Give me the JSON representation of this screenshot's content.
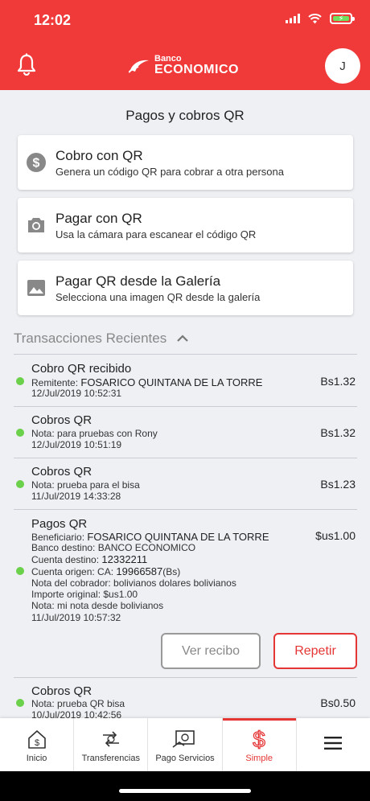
{
  "status": {
    "time": "12:02"
  },
  "header": {
    "logo_top": "Banco",
    "logo_bottom": "ECONOMICO",
    "avatar_initial": "J"
  },
  "page_title": "Pagos y cobros QR",
  "actions": [
    {
      "title": "Cobro con QR",
      "subtitle": "Genera un código QR para cobrar a otra persona",
      "icon": "dollar-circle-icon"
    },
    {
      "title": "Pagar con QR",
      "subtitle": "Usa la cámara para escanear el código QR",
      "icon": "camera-icon"
    },
    {
      "title": "Pagar QR desde la Galería",
      "subtitle": "Selecciona una imagen QR desde la galería",
      "icon": "image-icon"
    }
  ],
  "recent": {
    "heading": "Transacciones Recientes"
  },
  "transactions": [
    {
      "title": "Cobro QR recibido",
      "lines": [
        {
          "label": "Remitente:",
          "value": "FOSARICO QUINTANA DE LA TORRE"
        },
        {
          "label": "12/Jul/2019 10:52:31",
          "value": ""
        }
      ],
      "amount": "Bs1.32"
    },
    {
      "title": "Cobros QR",
      "lines": [
        {
          "label": "Nota: para pruebas con Rony",
          "value": ""
        },
        {
          "label": "12/Jul/2019 10:51:19",
          "value": ""
        }
      ],
      "amount": "Bs1.32"
    },
    {
      "title": "Cobros QR",
      "lines": [
        {
          "label": "Nota: prueba para el bisa",
          "value": ""
        },
        {
          "label": "11/Jul/2019 14:33:28",
          "value": ""
        }
      ],
      "amount": "Bs1.23"
    },
    {
      "title": "Pagos QR",
      "lines": [
        {
          "label": "Beneficiario:",
          "value": "FOSARICO QUINTANA DE LA TORRE"
        },
        {
          "label": "Banco destino: BANCO ECONOMICO",
          "value": ""
        },
        {
          "label": "Cuenta destino:",
          "value": "12332211"
        },
        {
          "label": "Cuenta origen:  CA:",
          "value": "19966587",
          "suffix": "(Bs)"
        },
        {
          "label": "Nota del cobrador: bolivianos dolares bolivianos",
          "value": ""
        },
        {
          "label": "Importe original: $us1.00",
          "value": ""
        },
        {
          "label": "Nota: mi nota desde bolivianos",
          "value": ""
        },
        {
          "label": "11/Jul/2019 10:57:32",
          "value": ""
        }
      ],
      "amount": "$us1.00"
    },
    {
      "title": "Cobros QR",
      "lines": [
        {
          "label": "Nota: prueba QR bisa",
          "value": ""
        },
        {
          "label": "10/Jul/2019 10:42:56",
          "value": ""
        }
      ],
      "amount": "Bs0.50"
    }
  ],
  "buttons": {
    "view_receipt": "Ver recibo",
    "repeat": "Repetir"
  },
  "nav": [
    {
      "label": "Inicio",
      "icon": "home-dollar-icon"
    },
    {
      "label": "Transferencias",
      "icon": "transfer-icon"
    },
    {
      "label": "Pago Servicios",
      "icon": "bill-icon"
    },
    {
      "label": "Simple",
      "icon": "dollar-icon",
      "active": true
    },
    {
      "label": "",
      "icon": "menu-icon"
    }
  ],
  "colors": {
    "brand": "#f03a3a",
    "accent": "#e53535",
    "success": "#6bd04a"
  }
}
